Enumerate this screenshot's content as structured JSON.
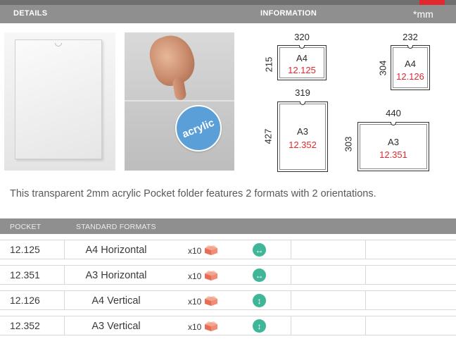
{
  "header": {
    "details": "DETAILS",
    "information": "INFORMATION",
    "unit": "*mm"
  },
  "colors": {
    "accent_red": "#e2282f",
    "header_gray": "#8f8f8f",
    "badge_blue": "#5a9fd8",
    "orientation_green": "#3fb698"
  },
  "photos": {
    "badge": "acrylic"
  },
  "formats": [
    {
      "width": "320",
      "height": "215",
      "format": "A4",
      "code": "12.125"
    },
    {
      "width": "232",
      "height": "304",
      "format": "A4",
      "code": "12.126"
    },
    {
      "width": "319",
      "height": "427",
      "format": "A3",
      "code": "12.352"
    },
    {
      "width": "440",
      "height": "303",
      "format": "A3",
      "code": "12.351"
    }
  ],
  "description": "This transparent 2mm acrylic Pocket folder features 2 formats with 2 orientations.",
  "table": {
    "columns": {
      "pocket": "POCKET",
      "formats": "STANDARD FORMATS"
    },
    "rows": [
      {
        "pocket": "12.125",
        "format": "A4 Horizontal",
        "qty": "x10",
        "orientation_icon": "horizontal-arrow-icon",
        "orientation_glyph": "↔"
      },
      {
        "pocket": "12.351",
        "format": "A3 Horizontal",
        "qty": "x10",
        "orientation_icon": "horizontal-arrow-icon",
        "orientation_glyph": "↔"
      },
      {
        "pocket": "12.126",
        "format": "A4 Vertical",
        "qty": "x10",
        "orientation_icon": "vertical-arrow-icon",
        "orientation_glyph": "↕"
      },
      {
        "pocket": "12.352",
        "format": "A3 Vertical",
        "qty": "x10",
        "orientation_icon": "vertical-arrow-icon",
        "orientation_glyph": "↕"
      }
    ]
  }
}
